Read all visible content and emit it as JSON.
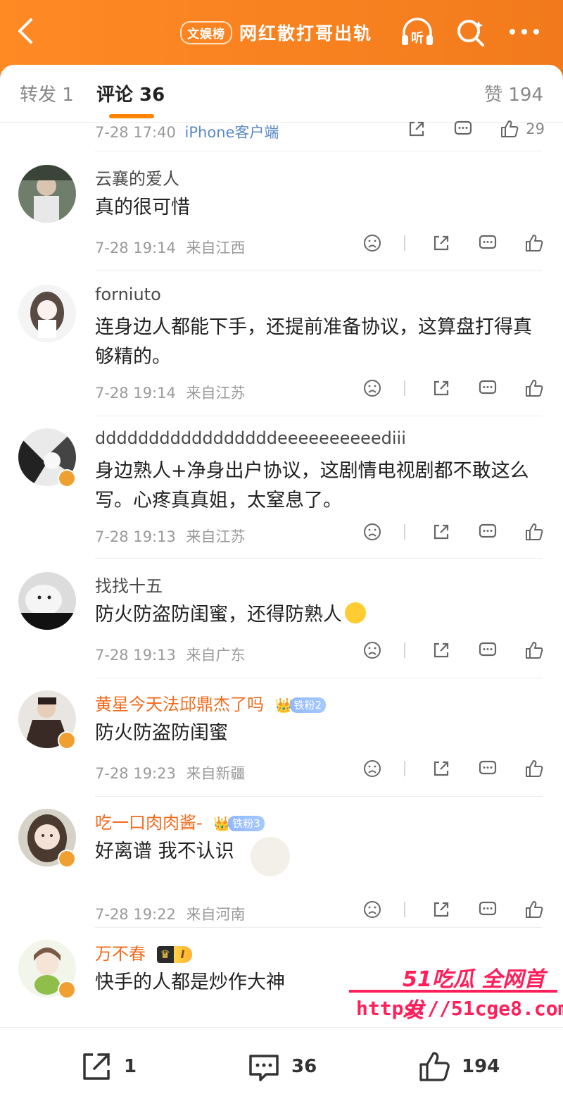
{
  "header": {
    "badge": "文娱榜",
    "title": "网红散打哥出轨",
    "listen_label": "听"
  },
  "tabs": {
    "forward": "转发 1",
    "comments": "评论 36",
    "likes": "赞 194"
  },
  "top_meta": {
    "time": "7-28 17:40",
    "source": "iPhone客户端",
    "likes": "29"
  },
  "comments": [
    {
      "user": "云襄的爱人",
      "text": "真的很可惜",
      "time": "7-28 19:14",
      "location": "来自江西"
    },
    {
      "user": "forniuto",
      "text": "连身边人都能下手，还提前准备协议，这算盘打得真够精的。",
      "time": "7-28 19:14",
      "location": "来自江苏"
    },
    {
      "user": "dddddddddddddddddeeeeeeeeeediii",
      "text": "身边熟人+净身出户协议，这剧情电视剧都不敢这么写。心疼真真姐，太窒息了。",
      "time": "7-28 19:13",
      "location": "来自江苏"
    },
    {
      "user": "找找十五",
      "text": "防火防盗防闺蜜，还得防熟人",
      "time": "7-28 19:13",
      "location": "来自广东"
    },
    {
      "user": "黄星今天法邱鼎杰了吗",
      "badge": "铁粉2",
      "text": "防火防盗防闺蜜",
      "time": "7-28 19:23",
      "location": "来自新疆"
    },
    {
      "user": "吃一口肉肉酱-",
      "badge": "铁粉3",
      "text": "好离谱 我不认识",
      "time": "7-28 19:22",
      "location": "来自河南"
    },
    {
      "user": "万不春",
      "badge": "I",
      "text": "快手的人都是炒作大神"
    }
  ],
  "bottom_bar": {
    "share_count": "1",
    "comment_count": "36",
    "like_count": "194"
  },
  "watermark": {
    "brand": "51吃瓜 全网首发",
    "url": "https://51cge8.com"
  },
  "colors": {
    "header": "#f27a1c",
    "accent": "#ff8200",
    "orange_name": "#f26b1d",
    "watermark": "#ff1f5a"
  }
}
